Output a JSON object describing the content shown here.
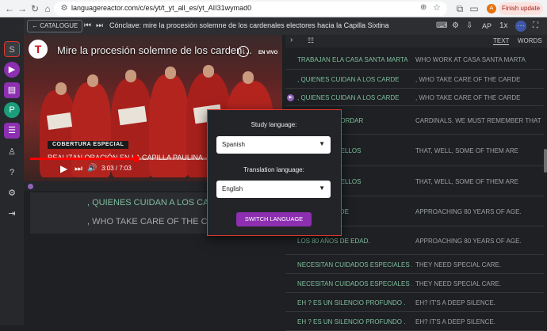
{
  "browser": {
    "url": "languagereactor.com/c/es/yt/t_yt_all_es/yt_AII31wymad0",
    "update_label": "Finish update",
    "profile_initial": "A"
  },
  "header": {
    "catalogue_label": "CATALOGUE",
    "title": "Cónclave: mire la procesión solemne de los cardenales electores hacia la Capilla Sixtina",
    "ap_label": "AP",
    "speed_label": "1x"
  },
  "video": {
    "title": "Mire la procesión solemne de los carden…",
    "logo_text": "T",
    "live_label": "EN VIVO",
    "banner_label": "COBERTURA ESPECIAL",
    "lower_third": "REALIZAN ORACIÓN EN LA CAPILLA PAULINA",
    "timecode": "3:03 / 7:03",
    "progress": 0.43
  },
  "subtitles": {
    "es": ", QUIENES CUIDAN A LOS CARDE",
    "en": ", WHO TAKE CARE OF THE CARDE"
  },
  "transcript": {
    "tab_text": "TEXT",
    "tab_words": "WORDS",
    "rows": [
      {
        "es": "TRABAJAN ELA CASA SANTA MARTA",
        "en": "WHO WORK AT CASA SANTA MARTA",
        "h": 26,
        "dim": false,
        "marker": false
      },
      {
        "es": ", QUIENES CUIDAN A LOS CARDE",
        "en": ", WHO TAKE CARE OF THE CARDE",
        "h": 24,
        "dim": false,
        "marker": false
      },
      {
        "es": ", QUIENES CUIDAN A LOS CARDE",
        "en": ", WHO TAKE CARE OF THE CARDE",
        "h": 22,
        "dim": false,
        "marker": true
      },
      {
        "es": "HAY QUE RECORDAR",
        "en": "CARDINALS. WE MUST REMEMBER THAT",
        "h": 36,
        "dim": false,
        "marker": false
      },
      {
        "es": "ALGUNOS DE ELLOS",
        "en": "THAT, WELL, SOME OF THEM ARE",
        "h": 40,
        "dim": false,
        "marker": false
      },
      {
        "es": "ALGUNOS DE ELLOS",
        "en": "THAT, WELL, SOME OF THEM ARE",
        "h": 38,
        "dim": false,
        "marker": false
      },
      {
        "es": "LOS 80 AÑOS DE",
        "en": "APPROACHING 80 YEARS OF AGE.",
        "h": 38,
        "dim": false,
        "marker": false
      },
      {
        "es": "LOS 80 AÑOS DE EDAD.",
        "en": "APPROACHING 80 YEARS OF AGE.",
        "h": 36,
        "dim": false,
        "marker": false
      },
      {
        "es": "NECESITAN CUIDADOS ESPECIALES .",
        "en": "THEY NEED SPECIAL CARE.",
        "h": 24,
        "dim": false,
        "marker": false
      },
      {
        "es": "NECESITAN CUIDADOS ESPECIALES .",
        "en": "THEY NEED SPECIAL CARE.",
        "h": 24,
        "dim": false,
        "marker": false
      },
      {
        "es": "EH ? ES UN SILENCIO PROFUNDO .",
        "en": "EH? IT'S A DEEP SILENCE.",
        "h": 24,
        "dim": false,
        "marker": false
      },
      {
        "es": "EH ? ES UN SILENCIO PROFUNDO .",
        "en": "EH? IT'S A DEEP SILENCE.",
        "h": 24,
        "dim": false,
        "marker": false
      }
    ]
  },
  "modal": {
    "study_label": "Study language:",
    "study_value": "Spanish",
    "translation_label": "Translation language:",
    "translation_value": "English",
    "button_label": "SWITCH LANGUAGE"
  },
  "colors": {
    "accent": "#8c2fb0",
    "modal_border": "#e0352b",
    "spanish_text": "#7fbf9e"
  }
}
